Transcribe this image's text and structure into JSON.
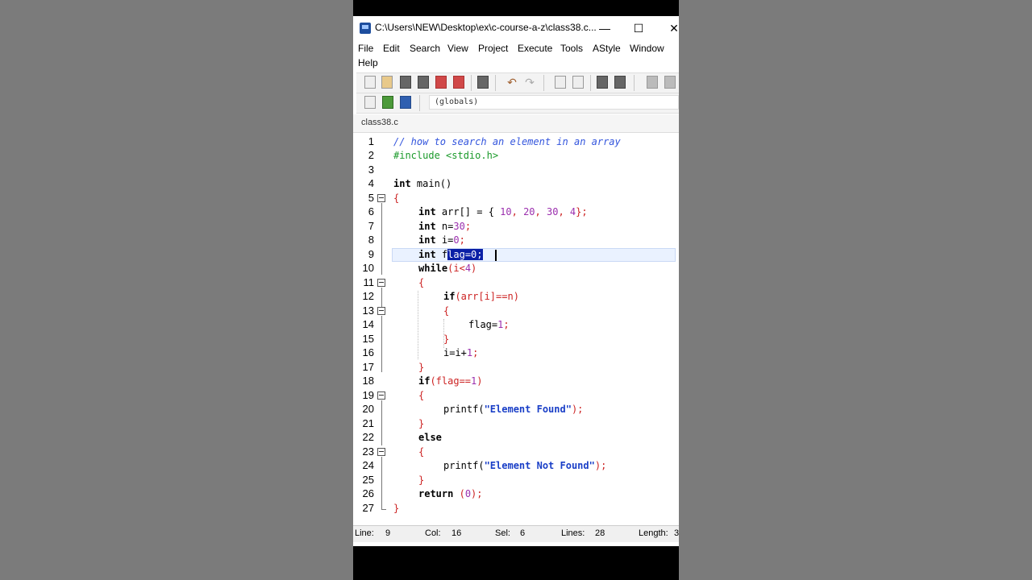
{
  "window": {
    "title": "C:\\Users\\NEW\\Desktop\\ex\\c-course-a-z\\class38.c...",
    "minimize": "—",
    "maximize": "☐",
    "close": "✕"
  },
  "menu": {
    "file": "File",
    "edit": "Edit",
    "search": "Search",
    "view": "View",
    "project": "Project",
    "execute": "Execute",
    "tools": "Tools",
    "astyle": "AStyle",
    "window": "Window",
    "help": "Help"
  },
  "toolbar": {
    "scope": "(globals)"
  },
  "tabs": {
    "active": "class38.c"
  },
  "lines": [
    "1",
    "2",
    "3",
    "4",
    "5",
    "6",
    "7",
    "8",
    "9",
    "10",
    "11",
    "12",
    "13",
    "14",
    "15",
    "16",
    "17",
    "18",
    "19",
    "20",
    "21",
    "22",
    "23",
    "24",
    "25",
    "26",
    "27"
  ],
  "code": {
    "l1": "// how to search an element in an array",
    "l2": "#include <stdio.h>",
    "kw_int": "int",
    "kw_while": "while",
    "kw_if": "if",
    "kw_else": "else",
    "kw_return": "return",
    "main": " main()",
    "brace_open": "{",
    "brace_close": "}",
    "l6_rest_a": " arr[] = { ",
    "l6_n1": "10",
    "comma": ", ",
    "l6_n2": "20",
    "l6_n3": "30",
    "l6_n4": "4",
    "l6_end": "};",
    "l7_a": " n=",
    "l7_n": "30",
    "semi": ";",
    "l8_a": " i=",
    "zero": "0",
    "l9_a": " f",
    "l9_sel": "lag=0;",
    "l10_a": "(i<",
    "l10_n": "4",
    "l10_b": ")",
    "l12_a": "(arr[i]==n)",
    "l14": "flag=",
    "one": "1",
    "l16": "i=i+",
    "l18_a": "(flag==",
    "l18_b": ")",
    "printf": "printf(",
    "s_found": "\"Element Found\"",
    "s_notfound": "\"Element Not Found\"",
    "close_paren_semi": ");",
    "ret_a": " (",
    "ret_b": ");"
  },
  "status": {
    "line_label": "Line:",
    "line_val": "9",
    "col_label": "Col:",
    "col_val": "16",
    "sel_label": "Sel:",
    "sel_val": "6",
    "lines_label": "Lines:",
    "lines_val": "28",
    "length_label": "Length:",
    "length_val": "3"
  }
}
